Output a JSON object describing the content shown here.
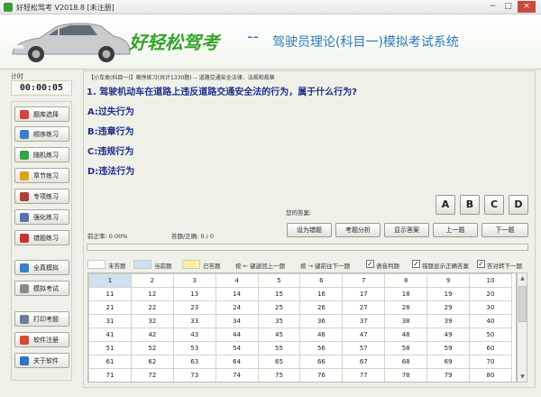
{
  "window": {
    "title": "好轻松驾考 V2018.8 [未注册]",
    "minimize": "−",
    "maximize": "□",
    "close": "×"
  },
  "banner": {
    "brand": "好轻松驾考",
    "dash": "--",
    "subtitle": "驾驶员理论(科目一)模拟考试系统"
  },
  "timer": {
    "label": "计时",
    "value": "00:00:05"
  },
  "sidebar": {
    "items": [
      {
        "label": "题库选择",
        "icon": "puzzle-icon",
        "color": "#d6453a"
      },
      {
        "label": "顺序练习",
        "icon": "list-icon",
        "color": "#3c7fc4"
      },
      {
        "label": "随机练习",
        "icon": "shuffle-icon",
        "color": "#3aa043"
      },
      {
        "label": "章节练习",
        "icon": "book-icon",
        "color": "#e0a020"
      },
      {
        "label": "专项练习",
        "icon": "check-icon",
        "color": "#b0403a"
      },
      {
        "label": "强化练习",
        "icon": "notebook-icon",
        "color": "#5a6fb0"
      },
      {
        "label": "错题练习",
        "icon": "error-icon",
        "color": "#c8352f"
      },
      {
        "label": "全真模拟",
        "icon": "exam-icon",
        "color": "#3c7fc4"
      },
      {
        "label": "模拟考试",
        "icon": "doc-icon",
        "color": "#8a8a8a"
      },
      {
        "label": "打印考题",
        "icon": "printer-icon",
        "color": "#6a7d9a"
      },
      {
        "label": "软件注册",
        "icon": "register-icon",
        "color": "#d24a30"
      },
      {
        "label": "关于软件",
        "icon": "info-icon",
        "color": "#3573c4"
      }
    ]
  },
  "question": {
    "breadcrumb": "【小车类(科目一)】顺序练习(共计1330题) -- 道路交通安全法律、法规和规章",
    "text": "1. 驾驶机动车在道路上违反道路交通安全法的行为，属于什么行为?",
    "options": [
      "A:过失行为",
      "B:违章行为",
      "C:违规行为",
      "D:违法行为"
    ]
  },
  "answer": {
    "label": "您的答案:",
    "choices": [
      "A",
      "B",
      "C",
      "D"
    ]
  },
  "stats": {
    "accuracy": "前正率: 0.00%",
    "count": "答题/正确: 0 / 0"
  },
  "actions": {
    "mark_wrong": "设为错题",
    "analysis": "考题分析",
    "show_answer": "显示答案",
    "prev": "上一题",
    "next": "下一题"
  },
  "progress": {
    "fraction": 0.0
  },
  "legend": {
    "unanswered": "未答题",
    "current": "当前题",
    "answered": "已答题",
    "key_prev": "按 ← 键返回上一题",
    "key_next": "按 → 键前往下一题",
    "voice": "语音判题",
    "wrong_show": "错题显示正确答案",
    "auto_next": "答对转下一题",
    "colors": {
      "unanswered": "#ffffff",
      "current": "#cfe0f0",
      "answered": "#fbf2a8"
    }
  },
  "grid": {
    "rows": [
      [
        "1",
        "2",
        "3",
        "4",
        "5",
        "6",
        "7",
        "8",
        "9",
        "10"
      ],
      [
        "11",
        "12",
        "13",
        "14",
        "15",
        "16",
        "17",
        "18",
        "19",
        "20"
      ],
      [
        "21",
        "22",
        "23",
        "24",
        "25",
        "26",
        "27",
        "28",
        "29",
        "30"
      ],
      [
        "31",
        "32",
        "33",
        "34",
        "35",
        "36",
        "37",
        "38",
        "39",
        "40"
      ],
      [
        "41",
        "42",
        "43",
        "44",
        "45",
        "46",
        "47",
        "48",
        "49",
        "50"
      ],
      [
        "51",
        "52",
        "53",
        "54",
        "55",
        "56",
        "57",
        "58",
        "59",
        "60"
      ],
      [
        "61",
        "62",
        "63",
        "64",
        "65",
        "66",
        "67",
        "68",
        "69",
        "70"
      ],
      [
        "71",
        "72",
        "73",
        "74",
        "75",
        "76",
        "77",
        "78",
        "79",
        "80"
      ]
    ]
  }
}
